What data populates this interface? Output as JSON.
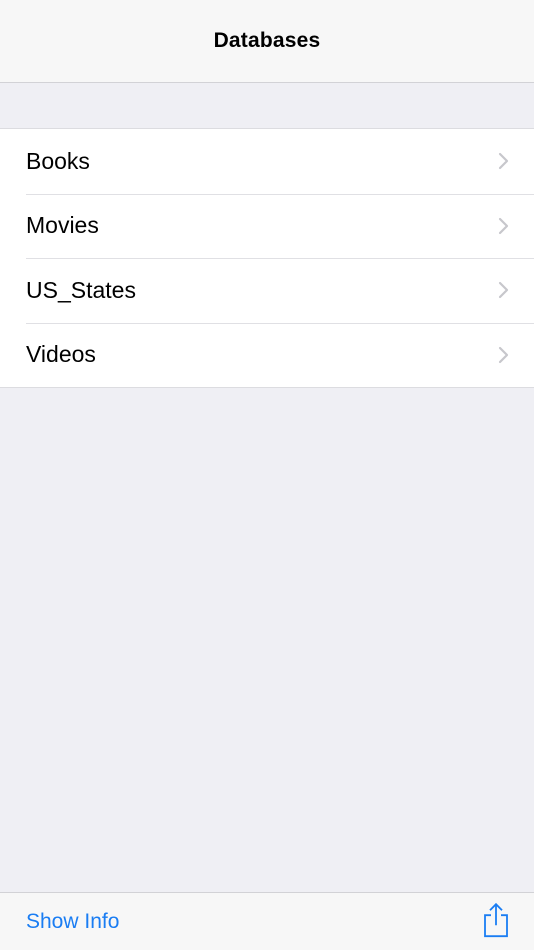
{
  "nav": {
    "title": "Databases"
  },
  "list": {
    "items": [
      {
        "label": "Books"
      },
      {
        "label": "Movies"
      },
      {
        "label": "US_States"
      },
      {
        "label": "Videos"
      }
    ]
  },
  "toolbar": {
    "show_info_label": "Show Info",
    "share_icon": "share-icon"
  },
  "colors": {
    "accent": "#1a7df3",
    "background": "#efeff4",
    "bar": "#f7f7f7",
    "chevron": "#c7c7cc"
  }
}
